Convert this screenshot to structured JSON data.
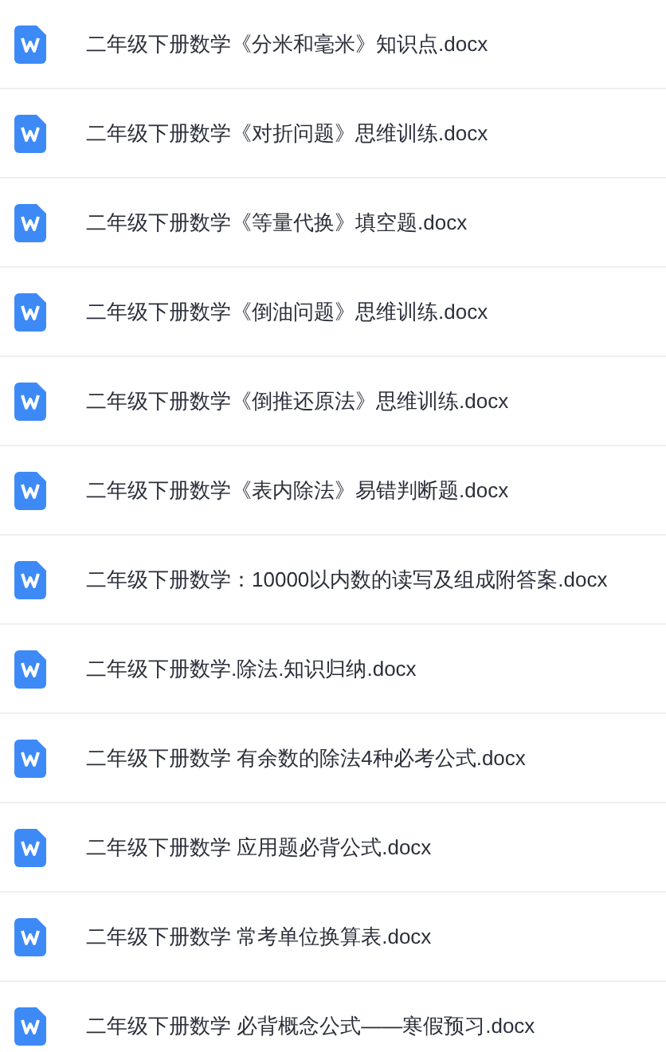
{
  "files": [
    {
      "name": "二年级下册数学《分米和毫米》知识点.docx"
    },
    {
      "name": "二年级下册数学《对折问题》思维训练.docx"
    },
    {
      "name": "二年级下册数学《等量代换》填空题.docx"
    },
    {
      "name": "二年级下册数学《倒油问题》思维训练.docx"
    },
    {
      "name": "二年级下册数学《倒推还原法》思维训练.docx"
    },
    {
      "name": "二年级下册数学《表内除法》易错判断题.docx"
    },
    {
      "name": "二年级下册数学：10000以内数的读写及组成附答案.docx"
    },
    {
      "name": "二年级下册数学.除法.知识归纳.docx"
    },
    {
      "name": "二年级下册数学 有余数的除法4种必考公式.docx"
    },
    {
      "name": "二年级下册数学 应用题必背公式.docx"
    },
    {
      "name": "二年级下册数学 常考单位换算表.docx"
    },
    {
      "name": "二年级下册数学 必背概念公式——寒假预习.docx"
    }
  ]
}
